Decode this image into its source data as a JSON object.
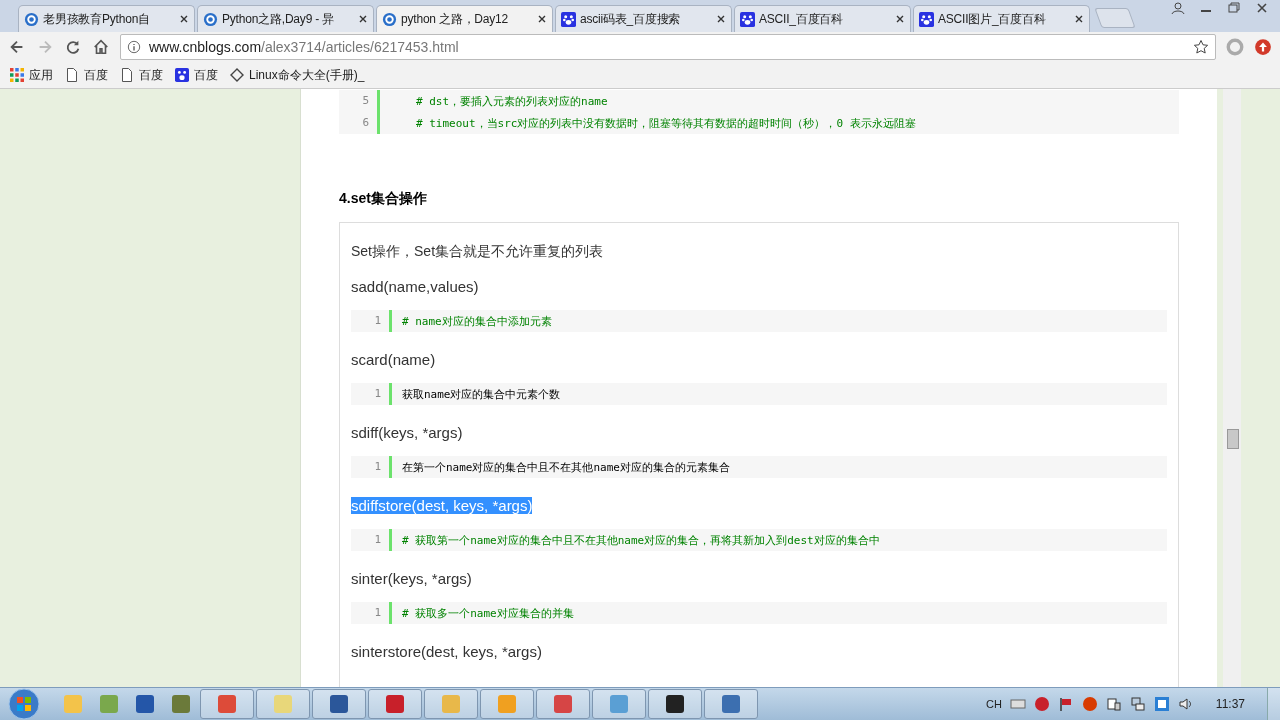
{
  "browser": {
    "tabs": [
      {
        "title": "老男孩教育Python自",
        "selected": false
      },
      {
        "title": "Python之路,Day9 - 异",
        "selected": false
      },
      {
        "title": "python 之路，Day12",
        "selected": true
      },
      {
        "title": "ascii码表_百度搜索",
        "selected": false
      },
      {
        "title": "ASCII_百度百科",
        "selected": false
      },
      {
        "title": "ASCII图片_百度百科",
        "selected": false
      }
    ],
    "url_host": "www.cnblogs.com",
    "url_path": "/alex3714/articles/6217453.html",
    "bookmarks": [
      {
        "label": "应用"
      },
      {
        "label": "百度"
      },
      {
        "label": "百度"
      },
      {
        "label": "百度"
      },
      {
        "label": "Linux命令大全(手册)_"
      }
    ]
  },
  "article": {
    "top_code": [
      {
        "number": "5",
        "text": "# dst，要插入元素的列表对应的name",
        "kind": "comment"
      },
      {
        "number": "6",
        "text": "# timeout，当src对应的列表中没有数据时，阻塞等待其有数据的超时时间（秒），0 表示永远阻塞",
        "kind": "comment"
      }
    ],
    "heading": "4.set集合操作",
    "intro": "Set操作，Set集合就是不允许重复的列表",
    "items": [
      {
        "signature": "sadd(name,values)",
        "selected": false,
        "code": [
          {
            "number": "1",
            "text": "# name对应的集合中添加元素",
            "kind": "comment"
          }
        ]
      },
      {
        "signature": "scard(name)",
        "selected": false,
        "code": [
          {
            "number": "1",
            "text": "获取name对应的集合中元素个数",
            "kind": "plain"
          }
        ]
      },
      {
        "signature": "sdiff(keys, *args)",
        "selected": false,
        "code": [
          {
            "number": "1",
            "text": "在第一个name对应的集合中且不在其他name对应的集合的元素集合",
            "kind": "plain"
          }
        ]
      },
      {
        "signature": "sdiffstore(dest, keys, *args)",
        "selected": true,
        "code": [
          {
            "number": "1",
            "text": "# 获取第一个name对应的集合中且不在其他name对应的集合，再将其新加入到dest对应的集合中",
            "kind": "comment"
          }
        ]
      },
      {
        "signature": "sinter(keys, *args)",
        "selected": false,
        "code": [
          {
            "number": "1",
            "text": "# 获取多一个name对应集合的并集",
            "kind": "comment"
          }
        ]
      },
      {
        "signature": "sinterstore(dest, keys, *args)",
        "selected": false
      }
    ]
  },
  "tray": {
    "language": "CH",
    "time": "11:37"
  }
}
